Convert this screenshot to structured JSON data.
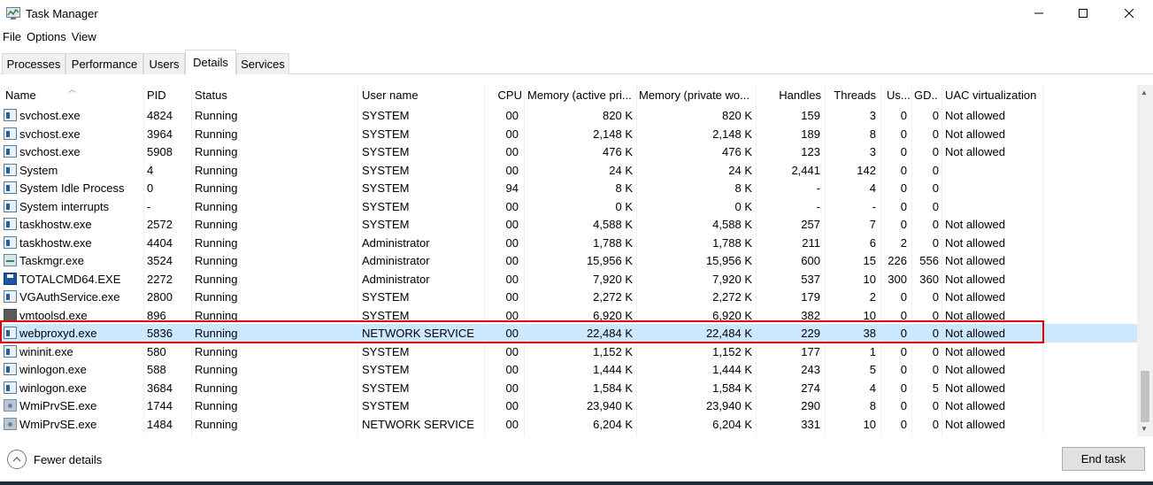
{
  "window": {
    "title": "Task Manager",
    "controls": {
      "minimize": "—",
      "maximize": "☐",
      "close": "✕"
    }
  },
  "menu": [
    "File",
    "Options",
    "View"
  ],
  "tabs": [
    {
      "label": "Processes",
      "active": false
    },
    {
      "label": "Performance",
      "active": false
    },
    {
      "label": "Users",
      "active": false
    },
    {
      "label": "Details",
      "active": true
    },
    {
      "label": "Services",
      "active": false
    }
  ],
  "columns": {
    "name": "Name",
    "pid": "PID",
    "status": "Status",
    "user": "User name",
    "cpu": "CPU",
    "mem_active": "Memory (active pri...",
    "mem_private": "Memory (private wo...",
    "handles": "Handles",
    "threads": "Threads",
    "user_objects": "Us...",
    "gdi": "GD...",
    "uac": "UAC virtualization"
  },
  "rows": [
    {
      "icon": "process-icon",
      "name": "svchost.exe",
      "pid": "4824",
      "status": "Running",
      "user": "SYSTEM",
      "cpu": "00",
      "mem_active": "820 K",
      "mem_private": "820 K",
      "handles": "159",
      "threads": "3",
      "user_objects": "0",
      "gdi": "0",
      "uac": "Not allowed",
      "selected": false
    },
    {
      "icon": "process-icon",
      "name": "svchost.exe",
      "pid": "3964",
      "status": "Running",
      "user": "SYSTEM",
      "cpu": "00",
      "mem_active": "2,148 K",
      "mem_private": "2,148 K",
      "handles": "189",
      "threads": "8",
      "user_objects": "0",
      "gdi": "0",
      "uac": "Not allowed",
      "selected": false
    },
    {
      "icon": "process-icon",
      "name": "svchost.exe",
      "pid": "5908",
      "status": "Running",
      "user": "SYSTEM",
      "cpu": "00",
      "mem_active": "476 K",
      "mem_private": "476 K",
      "handles": "123",
      "threads": "3",
      "user_objects": "0",
      "gdi": "0",
      "uac": "Not allowed",
      "selected": false
    },
    {
      "icon": "process-icon",
      "name": "System",
      "pid": "4",
      "status": "Running",
      "user": "SYSTEM",
      "cpu": "00",
      "mem_active": "24 K",
      "mem_private": "24 K",
      "handles": "2,441",
      "threads": "142",
      "user_objects": "0",
      "gdi": "0",
      "uac": "",
      "selected": false
    },
    {
      "icon": "process-icon",
      "name": "System Idle Process",
      "pid": "0",
      "status": "Running",
      "user": "SYSTEM",
      "cpu": "94",
      "mem_active": "8 K",
      "mem_private": "8 K",
      "handles": "-",
      "threads": "4",
      "user_objects": "0",
      "gdi": "0",
      "uac": "",
      "selected": false
    },
    {
      "icon": "process-icon",
      "name": "System interrupts",
      "pid": "-",
      "status": "Running",
      "user": "SYSTEM",
      "cpu": "00",
      "mem_active": "0 K",
      "mem_private": "0 K",
      "handles": "-",
      "threads": "-",
      "user_objects": "0",
      "gdi": "0",
      "uac": "",
      "selected": false
    },
    {
      "icon": "process-icon",
      "name": "taskhostw.exe",
      "pid": "2572",
      "status": "Running",
      "user": "SYSTEM",
      "cpu": "00",
      "mem_active": "4,588 K",
      "mem_private": "4,588 K",
      "handles": "257",
      "threads": "7",
      "user_objects": "0",
      "gdi": "0",
      "uac": "Not allowed",
      "selected": false
    },
    {
      "icon": "process-icon",
      "name": "taskhostw.exe",
      "pid": "4404",
      "status": "Running",
      "user": "Administrator",
      "cpu": "00",
      "mem_active": "1,788 K",
      "mem_private": "1,788 K",
      "handles": "211",
      "threads": "6",
      "user_objects": "2",
      "gdi": "0",
      "uac": "Not allowed",
      "selected": false
    },
    {
      "icon": "task-manager-icon",
      "name": "Taskmgr.exe",
      "pid": "3524",
      "status": "Running",
      "user": "Administrator",
      "cpu": "00",
      "mem_active": "15,956 K",
      "mem_private": "15,956 K",
      "handles": "600",
      "threads": "15",
      "user_objects": "226",
      "gdi": "556",
      "uac": "Not allowed",
      "selected": false
    },
    {
      "icon": "floppy-disk-icon",
      "name": "TOTALCMD64.EXE",
      "pid": "2272",
      "status": "Running",
      "user": "Administrator",
      "cpu": "00",
      "mem_active": "7,920 K",
      "mem_private": "7,920 K",
      "handles": "537",
      "threads": "10",
      "user_objects": "300",
      "gdi": "360",
      "uac": "Not allowed",
      "selected": false
    },
    {
      "icon": "process-icon",
      "name": "VGAuthService.exe",
      "pid": "2800",
      "status": "Running",
      "user": "SYSTEM",
      "cpu": "00",
      "mem_active": "2,272 K",
      "mem_private": "2,272 K",
      "handles": "179",
      "threads": "2",
      "user_objects": "0",
      "gdi": "0",
      "uac": "Not allowed",
      "selected": false
    },
    {
      "icon": "vm-icon",
      "name": "vmtoolsd.exe",
      "pid": "896",
      "status": "Running",
      "user": "SYSTEM",
      "cpu": "00",
      "mem_active": "6,920 K",
      "mem_private": "6,920 K",
      "handles": "382",
      "threads": "10",
      "user_objects": "0",
      "gdi": "0",
      "uac": "Not allowed",
      "selected": false
    },
    {
      "icon": "process-icon",
      "name": "webproxyd.exe",
      "pid": "5836",
      "status": "Running",
      "user": "NETWORK SERVICE",
      "cpu": "00",
      "mem_active": "22,484 K",
      "mem_private": "22,484 K",
      "handles": "229",
      "threads": "38",
      "user_objects": "0",
      "gdi": "0",
      "uac": "Not allowed",
      "selected": true
    },
    {
      "icon": "process-icon",
      "name": "wininit.exe",
      "pid": "580",
      "status": "Running",
      "user": "SYSTEM",
      "cpu": "00",
      "mem_active": "1,152 K",
      "mem_private": "1,152 K",
      "handles": "177",
      "threads": "1",
      "user_objects": "0",
      "gdi": "0",
      "uac": "Not allowed",
      "selected": false
    },
    {
      "icon": "process-icon",
      "name": "winlogon.exe",
      "pid": "588",
      "status": "Running",
      "user": "SYSTEM",
      "cpu": "00",
      "mem_active": "1,444 K",
      "mem_private": "1,444 K",
      "handles": "243",
      "threads": "5",
      "user_objects": "0",
      "gdi": "0",
      "uac": "Not allowed",
      "selected": false
    },
    {
      "icon": "process-icon",
      "name": "winlogon.exe",
      "pid": "3684",
      "status": "Running",
      "user": "SYSTEM",
      "cpu": "00",
      "mem_active": "1,584 K",
      "mem_private": "1,584 K",
      "handles": "274",
      "threads": "4",
      "user_objects": "0",
      "gdi": "5",
      "uac": "Not allowed",
      "selected": false
    },
    {
      "icon": "gear-process-icon",
      "name": "WmiPrvSE.exe",
      "pid": "1744",
      "status": "Running",
      "user": "SYSTEM",
      "cpu": "00",
      "mem_active": "23,940 K",
      "mem_private": "23,940 K",
      "handles": "290",
      "threads": "8",
      "user_objects": "0",
      "gdi": "0",
      "uac": "Not allowed",
      "selected": false
    },
    {
      "icon": "gear-process-icon",
      "name": "WmiPrvSE.exe",
      "pid": "1484",
      "status": "Running",
      "user": "NETWORK SERVICE",
      "cpu": "00",
      "mem_active": "6,204 K",
      "mem_private": "6,204 K",
      "handles": "331",
      "threads": "10",
      "user_objects": "0",
      "gdi": "0",
      "uac": "Not allowed",
      "selected": false
    }
  ],
  "footer": {
    "fewer_details": "Fewer details",
    "end_task": "End task"
  },
  "colors": {
    "selected_row": "#cce8ff",
    "highlight_border": "#e00000"
  }
}
